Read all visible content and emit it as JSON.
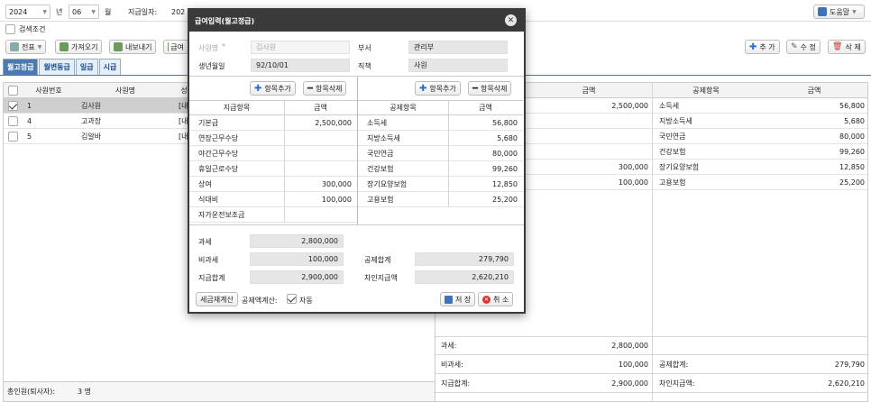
{
  "colors": {
    "accent": "#4a7ab0",
    "dialog_title_bg": "#3a3a3a",
    "row_selected": "#cfcfcf"
  },
  "filters": {
    "year": "2024",
    "year_unit": "년",
    "month": "06",
    "month_unit": "월",
    "pay_date_label": "지급일자:",
    "pay_date_value": "202",
    "search_condition": "검색조건",
    "help": "도움말"
  },
  "toolbar": {
    "slip": "전표",
    "import": "가져오기",
    "export": "내보내기",
    "partial": "급여",
    "add": "추 가",
    "edit": "수 정",
    "delete": "삭 제"
  },
  "tabs": [
    "월고정급",
    "월변동급",
    "일급",
    "시급"
  ],
  "emp_table": {
    "headers": [
      "사원번호",
      "사원명",
      "성"
    ],
    "rows": [
      {
        "no": "1",
        "name": "김사원",
        "d": "[내]",
        "checked": true,
        "selected": true
      },
      {
        "no": "4",
        "name": "고과장",
        "d": "[내]",
        "checked": false,
        "selected": false
      },
      {
        "no": "5",
        "name": "김알바",
        "d": "[내]",
        "checked": false,
        "selected": false
      }
    ],
    "footer_label": "총인원(퇴사자):",
    "footer_value": "3 명"
  },
  "right_grid": {
    "headers": [
      "금액",
      "공제항목",
      "금액"
    ],
    "pay_amounts": [
      "2,500,000",
      "",
      "",
      "",
      "300,000",
      "100,000"
    ],
    "deductions": [
      {
        "name": "소득세",
        "amount": "56,800"
      },
      {
        "name": "지방소득세",
        "amount": "5,680"
      },
      {
        "name": "국민연금",
        "amount": "80,000"
      },
      {
        "name": "건강보험",
        "amount": "99,260"
      },
      {
        "name": "장기요양보험",
        "amount": "12,850"
      },
      {
        "name": "고용보험",
        "amount": "25,200"
      }
    ],
    "summary": [
      {
        "label": "과세:",
        "value": "2,800,000",
        "label2": "",
        "value2": ""
      },
      {
        "label": "비과세:",
        "value": "100,000",
        "label2": "공제합계:",
        "value2": "279,790"
      },
      {
        "label": "지급합계:",
        "value": "2,900,000",
        "label2": "차인지급액:",
        "value2": "2,620,210"
      }
    ]
  },
  "dialog": {
    "title": "급여입력(월고정급)",
    "emp_name_label": "사원명",
    "emp_name_value": "김사원",
    "dept_label": "부서",
    "dept_value": "관리부",
    "birth_label": "생년월일",
    "birth_value": "92/10/01",
    "position_label": "직책",
    "position_value": "사원",
    "add_item": "항목추가",
    "del_item": "항목삭제",
    "pay_headers": [
      "지급항목",
      "금액"
    ],
    "pay_items": [
      {
        "name": "기본급",
        "amount": "2,500,000"
      },
      {
        "name": "연장근무수당",
        "amount": ""
      },
      {
        "name": "야간근무수당",
        "amount": ""
      },
      {
        "name": "휴일근로수당",
        "amount": ""
      },
      {
        "name": "상여",
        "amount": "300,000"
      },
      {
        "name": "식대비",
        "amount": "100,000"
      },
      {
        "name": "자가운전보조금",
        "amount": ""
      }
    ],
    "ded_headers": [
      "공제항목",
      "금액"
    ],
    "ded_items": [
      {
        "name": "소득세",
        "amount": "56,800"
      },
      {
        "name": "지방소득세",
        "amount": "5,680"
      },
      {
        "name": "국민연금",
        "amount": "80,000"
      },
      {
        "name": "건강보험",
        "amount": "99,260"
      },
      {
        "name": "장기요양보험",
        "amount": "12,850"
      },
      {
        "name": "고용보험",
        "amount": "25,200"
      }
    ],
    "taxable_label": "과세",
    "taxable_value": "2,800,000",
    "nontaxable_label": "비과세",
    "nontaxable_value": "100,000",
    "total_pay_label": "지급합계",
    "total_pay_value": "2,900,000",
    "total_ded_label": "공제합계",
    "total_ded_value": "279,790",
    "net_label": "차인지급액",
    "net_value": "2,620,210",
    "recalc": "세금재계산",
    "ded_calc_label": "공제액계산:",
    "auto": "자동",
    "save": "저 장",
    "cancel": "취 소"
  }
}
